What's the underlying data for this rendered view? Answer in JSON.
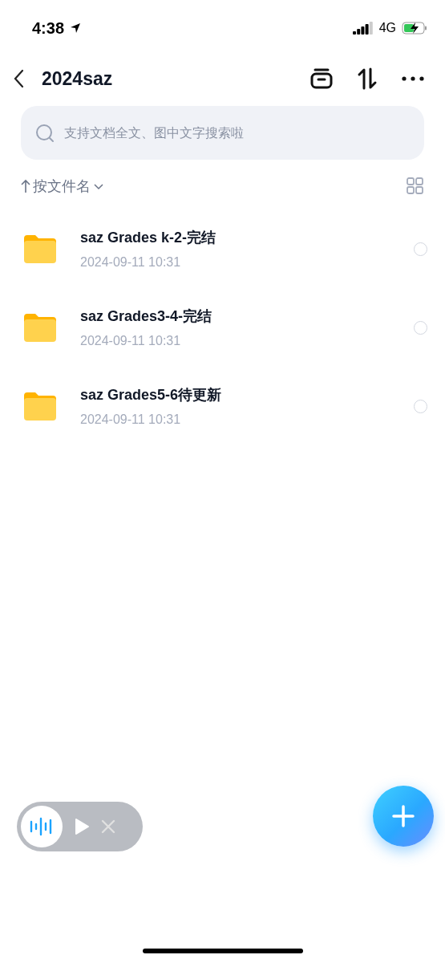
{
  "status_bar": {
    "time": "4:38",
    "network": "4G"
  },
  "header": {
    "title": "2024saz"
  },
  "search": {
    "placeholder": "支持文档全文、图中文字搜索啦"
  },
  "sort": {
    "label": "按文件名"
  },
  "files": [
    {
      "name": "saz Grades k-2-完结",
      "date": "2024-09-11 10:31",
      "selected": false
    },
    {
      "name": "saz Grades3-4-完结",
      "date": "2024-09-11 10:31",
      "selected": false
    },
    {
      "name": "saz Grades5-6待更新",
      "date": "2024-09-11 10:31",
      "selected": false
    }
  ]
}
